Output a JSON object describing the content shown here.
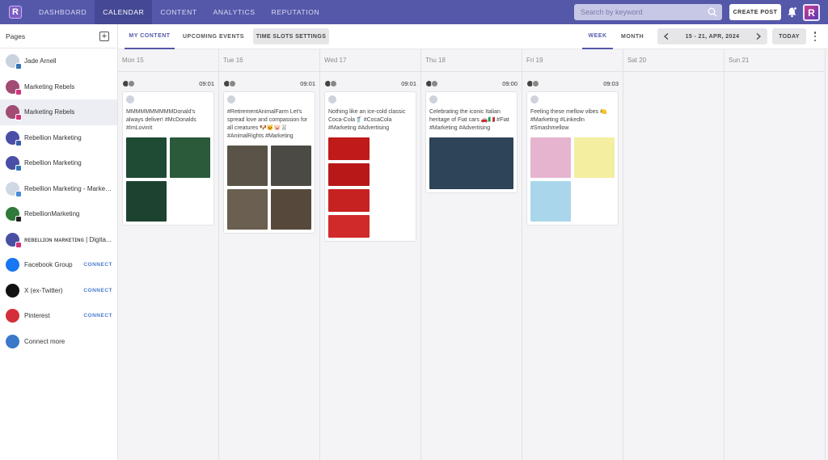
{
  "nav": {
    "items": [
      "DASHBOARD",
      "CALENDAR",
      "CONTENT",
      "ANALYTICS",
      "REPUTATION"
    ],
    "active": "CALENDAR",
    "search_placeholder": "Search by keyword",
    "create_label": "CREATE POST",
    "avatar_letter": "R",
    "logo_letter": "R"
  },
  "sidebar": {
    "title": "Pages",
    "items": [
      {
        "name": "Jade Arnell",
        "connect": "",
        "avatar": "#c9d3df",
        "badge": "#3573b8"
      },
      {
        "name": "Marketing Rebels",
        "connect": "",
        "avatar": "#a24b73",
        "badge": "#d1347a"
      },
      {
        "name": "Marketing Rebels",
        "connect": "",
        "avatar": "#a24b73",
        "badge": "#d1347a"
      },
      {
        "name": "Rebellion Marketing",
        "connect": "",
        "avatar": "#4a4fa6",
        "badge": "#3b5ca8"
      },
      {
        "name": "Rebellion Marketing",
        "connect": "",
        "avatar": "#4a4fa6",
        "badge": "#3573b8"
      },
      {
        "name": "Rebellion Marketing - Marketi...",
        "connect": "",
        "avatar": "#cfd8e3",
        "badge": "#4a8bd8"
      },
      {
        "name": "RebellionMarketing",
        "connect": "",
        "avatar": "#2f7a3a",
        "badge": "#222222"
      },
      {
        "name": "ʀᴇʙᴇʟʟɪᴏɴ ᴍᴀʀᴋᴇᴛɪɴɢ | Digita...",
        "connect": "",
        "avatar": "#4a4fa6",
        "badge": "#d1347a"
      },
      {
        "name": "Facebook Group",
        "connect": "CONNECT",
        "avatar": "#1877f2",
        "badge": ""
      },
      {
        "name": "X (ex-Twitter)",
        "connect": "CONNECT",
        "avatar": "#111111",
        "badge": ""
      },
      {
        "name": "Pinterest",
        "connect": "CONNECT",
        "avatar": "#d32f3a",
        "badge": ""
      },
      {
        "name": "Connect more",
        "connect": "",
        "avatar": "#3a78c9",
        "badge": ""
      }
    ],
    "selected_index": 2
  },
  "toolbar": {
    "tab_my_content": "MY CONTENT",
    "tab_upcoming": "UPCOMING EVENTS",
    "time_slots": "TIME SLOTS SETTINGS",
    "view_week": "WEEK",
    "view_month": "MONTH",
    "date_range": "15 - 21, APR, 2024",
    "today": "TODAY"
  },
  "calendar": {
    "days": [
      {
        "label": "Mon 15",
        "time": "09:01",
        "text": "MMMMMMMMMMDonald's always deliver! #McDonalds #ImLovinIt",
        "thumbs": [
          "#1f4a34",
          "#2a5a3a",
          "#1d4330"
        ],
        "thumb_style": "square"
      },
      {
        "label": "Tue 16",
        "time": "09:01",
        "text": "#RetirementAnimalFarm Let's spread love and compassion for all creatures 🐶🐱🐷🐰 #AnimalRights #Marketing",
        "thumbs": [
          "#5a5448",
          "#4c4a44",
          "#6a5f50",
          "#56493c"
        ],
        "thumb_style": "square"
      },
      {
        "label": "Wed 17",
        "time": "09:01",
        "text": "Nothing like an ice-cold classic Coca-Cola🥤 #CocaCola #Marketing #Advertising",
        "thumbs": [
          "#c01a1a",
          "#b81818",
          "#c62222",
          "#d02a2a"
        ],
        "thumb_style": "wide"
      },
      {
        "label": "Thu 18",
        "time": "09:00",
        "text": "Celebrating the iconic Italian heritage of Fiat cars 🚗🇮🇹 #Fiat #Marketing #Advertising",
        "thumbs": [
          "#2e4457"
        ],
        "thumb_style": "full"
      },
      {
        "label": "Fri 19",
        "time": "09:03",
        "text": "Feeling these mellow vibes 🍋 #Marketing #LinkedIn #Smashmellow",
        "thumbs": [
          "#e6b4cf",
          "#f4eea0",
          "#a9d6ea"
        ],
        "thumb_style": "square"
      },
      {
        "label": "Sat 20",
        "time": "",
        "text": "",
        "thumbs": [],
        "thumb_style": ""
      },
      {
        "label": "Sun 21",
        "time": "",
        "text": "",
        "thumbs": [],
        "thumb_style": ""
      }
    ]
  },
  "colors": {
    "brand": "#5558a9",
    "nav_active": "#454894",
    "connect": "#4a7bd0",
    "calendar_bg": "#f4f4f6"
  }
}
